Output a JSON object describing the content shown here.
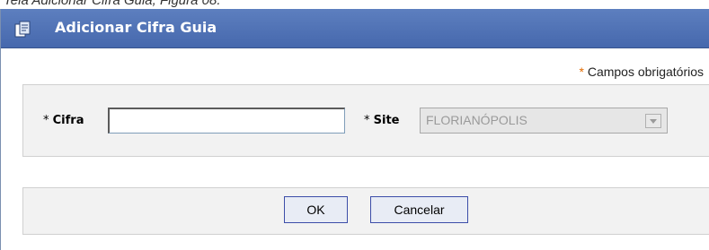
{
  "caption": "Tela Adicionar Cifra Guia, Figura 08.",
  "dialog": {
    "title": "Adicionar Cifra Guia",
    "icon": "document-icon"
  },
  "form": {
    "required_star": "*",
    "required_text": "Campos obrigatórios",
    "cifra": {
      "star": "*",
      "label": "Cifra",
      "value": ""
    },
    "site": {
      "star": "*",
      "label": "Site",
      "selected": "FLORIANÓPOLIS"
    }
  },
  "actions": {
    "ok_label": "OK",
    "cancel_label": "Cancelar"
  },
  "colors": {
    "titlebar": "#4f72b4",
    "required_star": "#e36b00",
    "button_border": "#3c4da8"
  }
}
